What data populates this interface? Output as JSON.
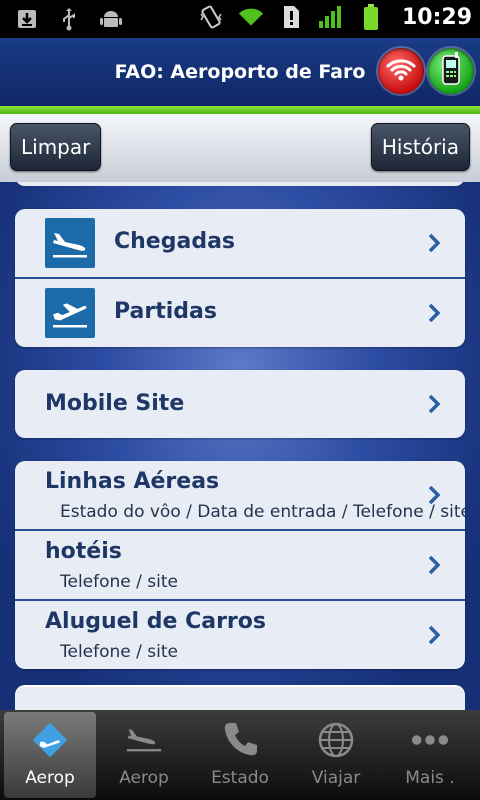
{
  "status_bar": {
    "time": "10:29",
    "icons": [
      "download-icon",
      "usb-icon",
      "android-icon",
      "vibrate-icon",
      "wifi-signal-icon",
      "alert-icon",
      "cell-signal-icon",
      "battery-icon"
    ]
  },
  "header": {
    "title": "FAO: Aeroporto de Faro",
    "buttons": [
      "wifi-icon",
      "phone-icon"
    ]
  },
  "toolbar": {
    "left_label": "Limpar",
    "right_label": "História"
  },
  "flights": [
    {
      "label": "Chegadas",
      "icon": "plane-arrival-icon"
    },
    {
      "label": "Partidas",
      "icon": "plane-departure-icon"
    }
  ],
  "mobile_site": {
    "label": "Mobile Site"
  },
  "services": [
    {
      "label": "Linhas Aéreas",
      "sub": "Estado do vôo / Data de entrada / Telefone / site"
    },
    {
      "label": "hotéis",
      "sub": "Telefone / site"
    },
    {
      "label": "Aluguel de Carros",
      "sub": "Telefone / site"
    }
  ],
  "tabs": [
    {
      "label": "Aerop",
      "icon": "plane-icon",
      "active": true
    },
    {
      "label": "Aerop",
      "icon": "plane-landing-icon",
      "active": false
    },
    {
      "label": "Estado",
      "icon": "phone-icon",
      "active": false
    },
    {
      "label": "Viajar",
      "icon": "globe-icon",
      "active": false
    },
    {
      "label": "Mais .",
      "icon": "more-icon",
      "active": false
    }
  ],
  "colors": {
    "header": "#1a3c87",
    "accent": "#6ccf23",
    "row_label": "#1f3766",
    "icon_bg": "#1d6aa8"
  }
}
